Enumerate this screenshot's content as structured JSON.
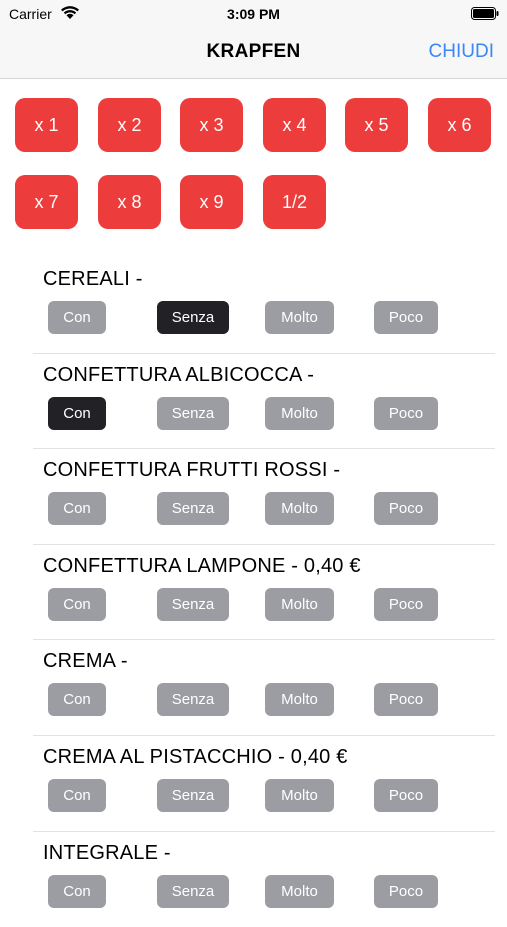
{
  "status_bar": {
    "carrier": "Carrier",
    "time": "3:09 PM"
  },
  "nav": {
    "title": "KRAPFEN",
    "close_label": "CHIUDI"
  },
  "multipliers": [
    "x 1",
    "x 2",
    "x 3",
    "x 4",
    "x 5",
    "x 6",
    "x 7",
    "x 8",
    "x 9",
    "1/2"
  ],
  "option_labels": {
    "con": "Con",
    "senza": "Senza",
    "molto": "Molto",
    "poco": "Poco"
  },
  "options": [
    {
      "title": "CEREALI -",
      "selected": "senza"
    },
    {
      "title": "CONFETTURA ALBICOCCA -",
      "selected": "con"
    },
    {
      "title": "CONFETTURA FRUTTI ROSSI -",
      "selected": ""
    },
    {
      "title": "CONFETTURA LAMPONE - 0,40 €",
      "selected": ""
    },
    {
      "title": "CREMA -",
      "selected": ""
    },
    {
      "title": "CREMA AL PISTACCHIO - 0,40 €",
      "selected": ""
    },
    {
      "title": "INTEGRALE -",
      "selected": ""
    }
  ],
  "colors": {
    "accent_red": "#ec3c3c",
    "link_blue": "#3a87f5",
    "button_gray": "#9c9ca3",
    "button_selected": "#222226"
  }
}
